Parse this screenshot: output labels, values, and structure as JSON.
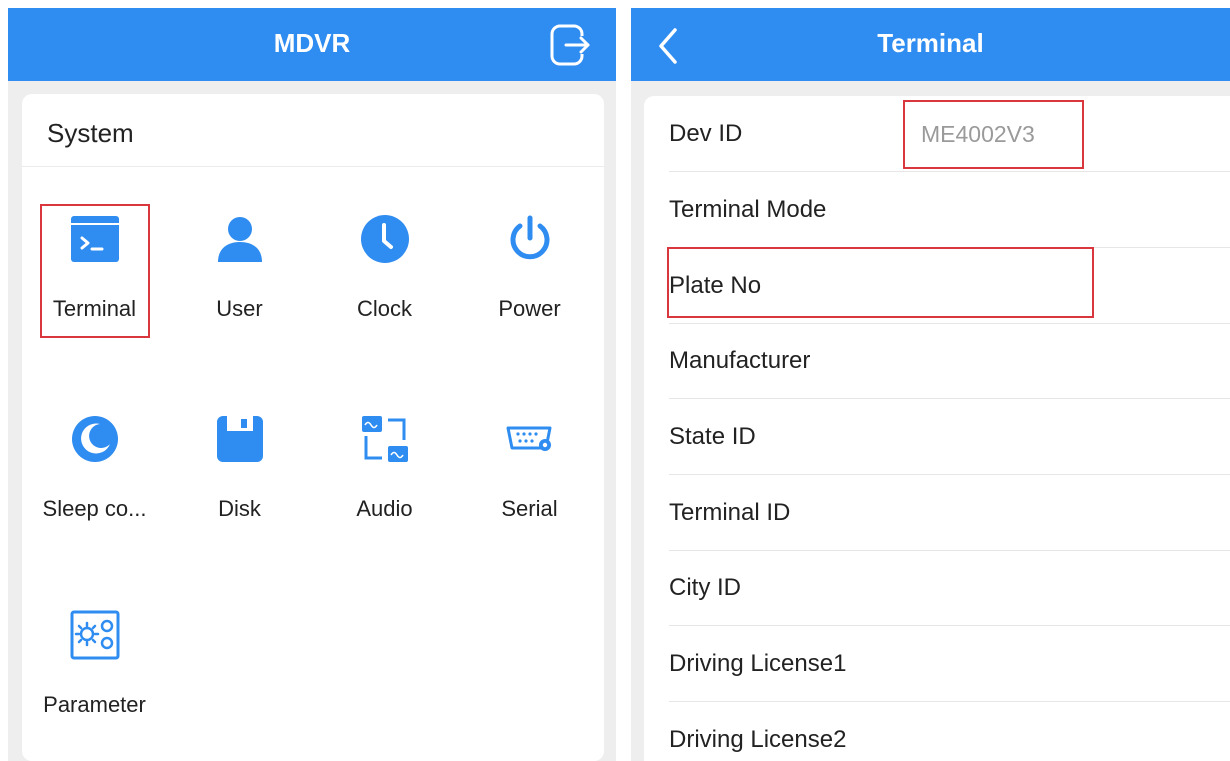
{
  "left": {
    "header": {
      "title": "MDVR",
      "exit_icon": "exit-icon"
    },
    "section": {
      "title": "System"
    },
    "items": [
      {
        "label": "Terminal",
        "icon": "terminal-icon"
      },
      {
        "label": "User",
        "icon": "user-icon"
      },
      {
        "label": "Clock",
        "icon": "clock-icon"
      },
      {
        "label": "Power",
        "icon": "power-icon"
      },
      {
        "label": "Sleep co...",
        "icon": "sleep-icon"
      },
      {
        "label": "Disk",
        "icon": "disk-icon"
      },
      {
        "label": "Audio",
        "icon": "audio-icon"
      },
      {
        "label": "Serial",
        "icon": "serial-port-icon"
      },
      {
        "label": "Parameter",
        "icon": "parameter-icon"
      }
    ]
  },
  "right": {
    "header": {
      "title": "Terminal",
      "back_icon": "back-icon"
    },
    "rows": [
      {
        "label": "Dev ID",
        "value": "ME4002V3"
      },
      {
        "label": "Terminal Mode",
        "value": ""
      },
      {
        "label": "Plate No",
        "value": ""
      },
      {
        "label": "Manufacturer",
        "value": ""
      },
      {
        "label": "State ID",
        "value": ""
      },
      {
        "label": "Terminal ID",
        "value": ""
      },
      {
        "label": "City ID",
        "value": ""
      },
      {
        "label": "Driving License1",
        "value": ""
      },
      {
        "label": "Driving License2",
        "value": ""
      }
    ]
  },
  "colors": {
    "accent": "#2f8cf0",
    "highlight": "#d9363e",
    "background": "#eeeeee"
  }
}
